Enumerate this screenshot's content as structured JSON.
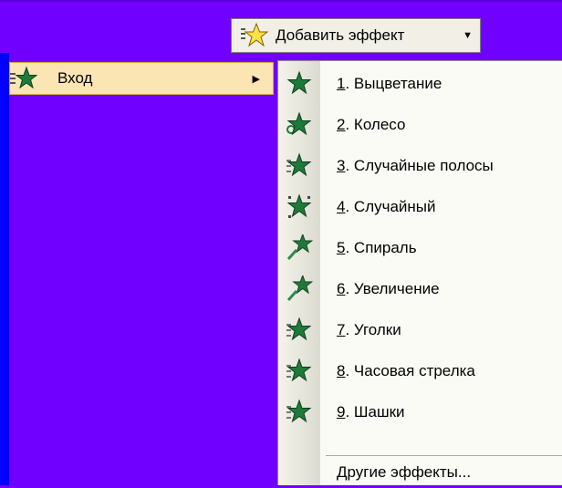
{
  "toolbar": {
    "add_effect_label": "Добавить эффект",
    "icon": "add-effect-star-icon"
  },
  "menu": {
    "entrance_label": "Вход",
    "entrance_icon": "green-star-icon"
  },
  "submenu": {
    "items": [
      {
        "num": "1",
        "label": ". Выцветание",
        "icon": "fade-star-icon"
      },
      {
        "num": "2",
        "label": ". Колесо",
        "icon": "wheel-star-icon"
      },
      {
        "num": "3",
        "label": ". Случайные полосы",
        "icon": "random-bars-star-icon"
      },
      {
        "num": "4",
        "label": ". Случайный",
        "icon": "random-star-icon"
      },
      {
        "num": "5",
        "label": ". Спираль",
        "icon": "spiral-star-icon"
      },
      {
        "num": "6",
        "label": ". Увеличение",
        "icon": "zoom-star-icon"
      },
      {
        "num": "7",
        "label": ". Уголки",
        "icon": "corners-star-icon"
      },
      {
        "num": "8",
        "label": ". Часовая стрелка",
        "icon": "clockwise-star-icon"
      },
      {
        "num": "9",
        "label": ". Шашки",
        "icon": "checkers-star-icon"
      }
    ],
    "more_label": "Другие эффекты..."
  },
  "colors": {
    "background": "#7000ff",
    "menu_highlight": "#fbe5b2",
    "star_green": "#1f7a3a"
  }
}
